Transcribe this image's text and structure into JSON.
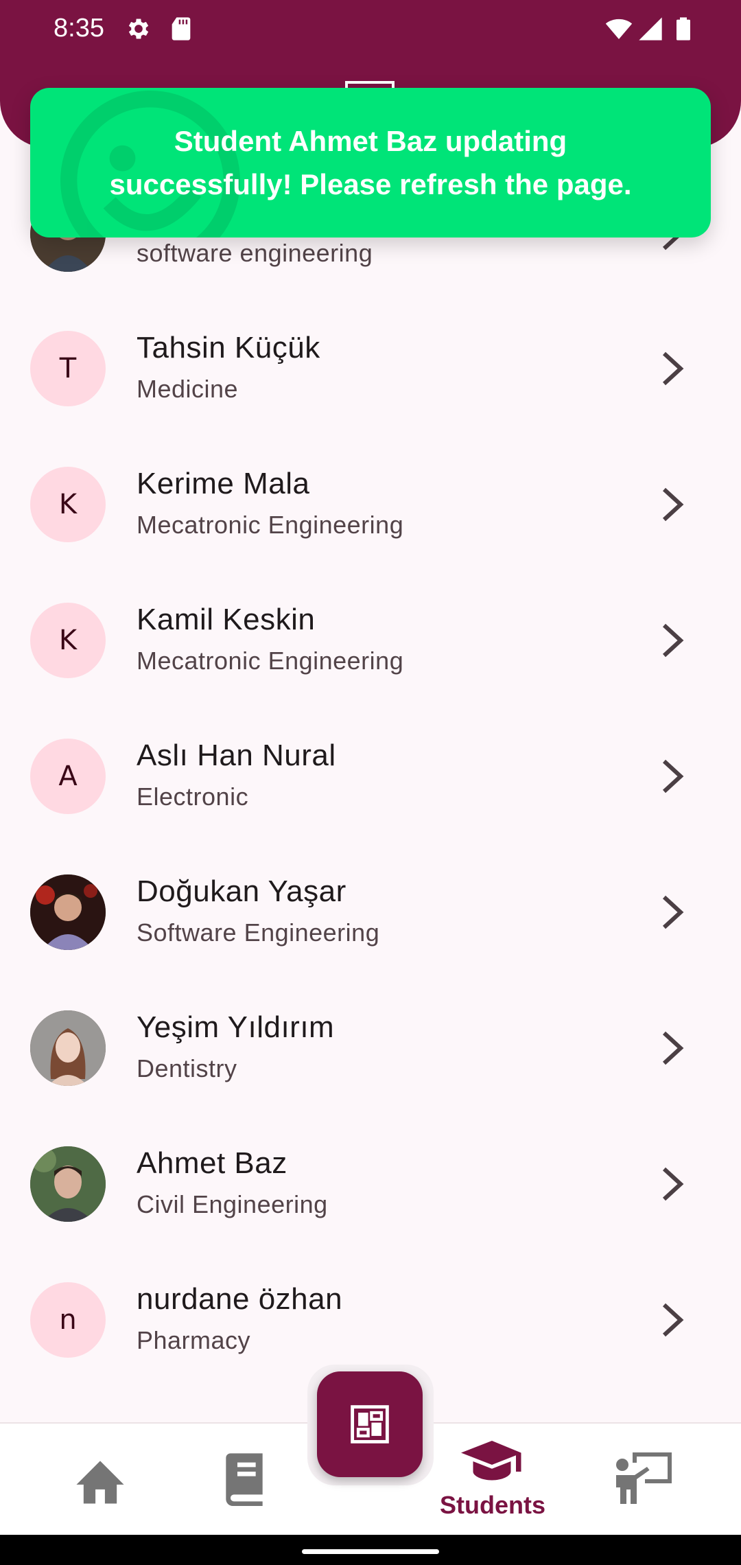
{
  "status_bar": {
    "time": "8:35",
    "icons": [
      "settings-gear-icon",
      "sd-card-icon",
      "wifi-icon",
      "cellular-signal-icon",
      "battery-icon"
    ]
  },
  "toast": {
    "message": "Student Ahmet Baz updating successfully! Please refresh the page.",
    "background": "#00e478"
  },
  "students": [
    {
      "name": "",
      "department": "software engineering",
      "initial": "",
      "photo": true
    },
    {
      "name": "Tahsin Küçük",
      "department": "Medicine",
      "initial": "T",
      "photo": false
    },
    {
      "name": "Kerime Mala",
      "department": "Mecatronic Engineering",
      "initial": "K",
      "photo": false
    },
    {
      "name": "Kamil Keskin",
      "department": "Mecatronic Engineering",
      "initial": "K",
      "photo": false
    },
    {
      "name": "Aslı Han Nural",
      "department": "Electronic",
      "initial": "A",
      "photo": false
    },
    {
      "name": "Doğukan Yaşar",
      "department": "Software Engineering",
      "initial": "",
      "photo": true
    },
    {
      "name": "Yeşim Yıldırım",
      "department": "Dentistry",
      "initial": "",
      "photo": true
    },
    {
      "name": "Ahmet Baz",
      "department": "Civil Engineering",
      "initial": "",
      "photo": true
    },
    {
      "name": "nurdane özhan",
      "department": "Pharmacy",
      "initial": "n",
      "photo": false
    }
  ],
  "bottom_nav": {
    "items": [
      {
        "icon": "home-icon",
        "label": ""
      },
      {
        "icon": "book-icon",
        "label": ""
      },
      {
        "icon": "graduation-cap-icon",
        "label": "Students"
      },
      {
        "icon": "teacher-board-icon",
        "label": ""
      }
    ],
    "fab_icon": "dashboard-icon"
  },
  "colors": {
    "primary": "#7a1342",
    "toast": "#00e478",
    "avatar_bg": "#ffd9e2",
    "nav_inactive": "#757575"
  }
}
